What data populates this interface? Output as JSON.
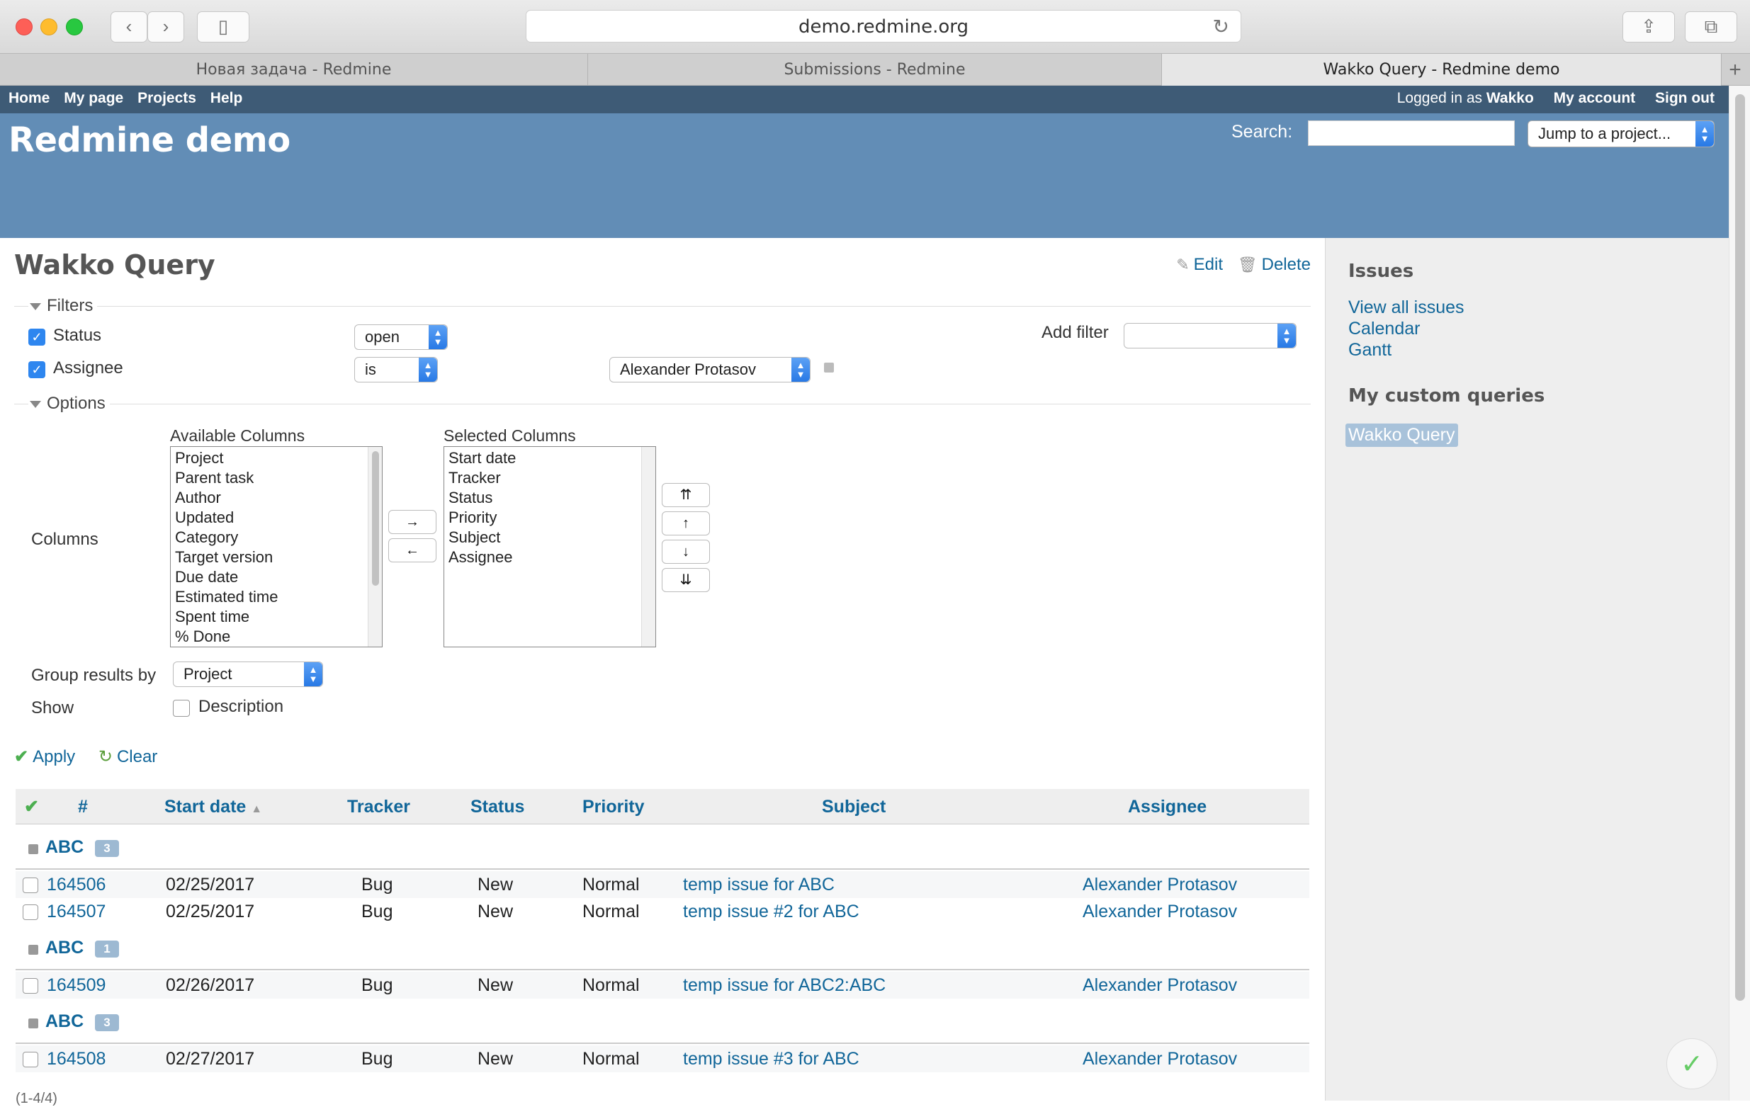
{
  "browser": {
    "url": "demo.redmine.org",
    "tabs": [
      {
        "label": "Новая задача - Redmine",
        "active": false
      },
      {
        "label": "Submissions - Redmine",
        "active": false
      },
      {
        "label": "Wakko Query - Redmine demo",
        "active": true
      }
    ]
  },
  "topmenu": {
    "left": [
      "Home",
      "My page",
      "Projects",
      "Help"
    ],
    "logged_in_prefix": "Logged in as",
    "user": "Wakko",
    "my_account": "My account",
    "sign_out": "Sign out"
  },
  "header": {
    "title": "Redmine demo",
    "search_label": "Search:",
    "jump_label": "Jump to a project..."
  },
  "query": {
    "title": "Wakko Query",
    "edit": "Edit",
    "delete": "Delete",
    "filters_legend": "Filters",
    "filters": [
      {
        "field": "Status",
        "operator": "open",
        "value": ""
      },
      {
        "field": "Assignee",
        "operator": "is",
        "value": "Alexander Protasov"
      }
    ],
    "add_filter": "Add filter",
    "options_legend": "Options",
    "columns_label": "Columns",
    "available_columns_label": "Available Columns",
    "available_columns": [
      "Project",
      "Parent task",
      "Author",
      "Updated",
      "Category",
      "Target version",
      "Due date",
      "Estimated time",
      "Spent time",
      "% Done"
    ],
    "selected_columns_label": "Selected Columns",
    "selected_columns": [
      "Start date",
      "Tracker",
      "Status",
      "Priority",
      "Subject",
      "Assignee"
    ],
    "move_right": "→",
    "move_left": "←",
    "move_top": "⇈",
    "move_up": "↑",
    "move_down": "↓",
    "move_bottom": "⇊",
    "group_by_label": "Group results by",
    "group_by_value": "Project",
    "show_label": "Show",
    "show_description": "Description",
    "apply": "Apply",
    "clear": "Clear"
  },
  "table": {
    "headers": {
      "check": "✔",
      "id": "#",
      "start_date": "Start date",
      "sort_arrow": "▲",
      "tracker": "Tracker",
      "status": "Status",
      "priority": "Priority",
      "subject": "Subject",
      "assignee": "Assignee"
    },
    "groups": [
      {
        "name": "ABC",
        "count": "3",
        "rows": [
          {
            "id": "164506",
            "start": "02/25/2017",
            "tracker": "Bug",
            "status": "New",
            "priority": "Normal",
            "subject": "temp issue for ABC",
            "assignee": "Alexander Protasov"
          },
          {
            "id": "164507",
            "start": "02/25/2017",
            "tracker": "Bug",
            "status": "New",
            "priority": "Normal",
            "subject": "temp issue #2 for ABC",
            "assignee": "Alexander Protasov"
          }
        ]
      },
      {
        "name": "ABC",
        "count": "1",
        "rows": [
          {
            "id": "164509",
            "start": "02/26/2017",
            "tracker": "Bug",
            "status": "New",
            "priority": "Normal",
            "subject": "temp issue for ABC2:ABC",
            "assignee": "Alexander Protasov"
          }
        ]
      },
      {
        "name": "ABC",
        "count": "3",
        "rows": [
          {
            "id": "164508",
            "start": "02/27/2017",
            "tracker": "Bug",
            "status": "New",
            "priority": "Normal",
            "subject": "temp issue #3 for ABC",
            "assignee": "Alexander Protasov"
          }
        ]
      }
    ],
    "pagination": "(1-4/4)"
  },
  "sidebar": {
    "issues_heading": "Issues",
    "links": [
      "View all issues",
      "Calendar",
      "Gantt"
    ],
    "custom_heading": "My custom queries",
    "custom_queries": [
      "Wakko Query"
    ]
  },
  "colors": {
    "header": "#628db6",
    "topmenu": "#3e5b76",
    "link": "#116699"
  }
}
